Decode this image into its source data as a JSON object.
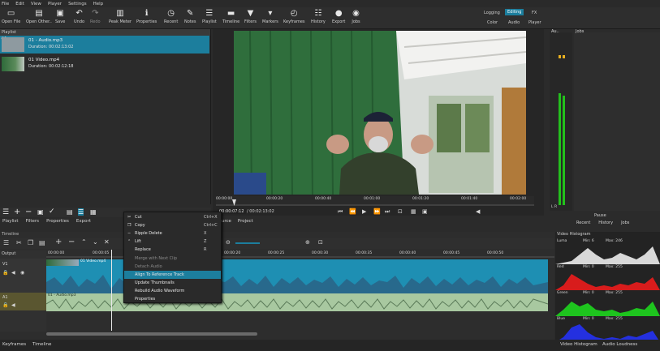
{
  "menu": [
    "File",
    "Edit",
    "View",
    "Player",
    "Settings",
    "Help"
  ],
  "toolbar": [
    {
      "label": "Open File",
      "icon": "folder-icon"
    },
    {
      "label": "Open Other..",
      "icon": "open-other-icon"
    },
    {
      "label": "Save",
      "icon": "save-icon"
    },
    {
      "label": "Undo",
      "icon": "undo-icon"
    },
    {
      "label": "Redo",
      "icon": "redo-icon"
    },
    {
      "label": "Peak Meter",
      "icon": "peak-meter-icon"
    },
    {
      "label": "Properties",
      "icon": "properties-icon"
    },
    {
      "label": "Recent",
      "icon": "recent-icon"
    },
    {
      "label": "Notes",
      "icon": "notes-icon"
    },
    {
      "label": "Playlist",
      "icon": "playlist-icon"
    },
    {
      "label": "Timeline",
      "icon": "timeline-icon"
    },
    {
      "label": "Filters",
      "icon": "filters-icon"
    },
    {
      "label": "Markers",
      "icon": "markers-icon"
    },
    {
      "label": "Keyframes",
      "icon": "keyframes-icon"
    },
    {
      "label": "History",
      "icon": "history-icon"
    },
    {
      "label": "Export",
      "icon": "export-icon"
    },
    {
      "label": "Jobs",
      "icon": "jobs-icon"
    }
  ],
  "layouts": {
    "logging": "Logging",
    "editing": "Editing",
    "fx": "FX",
    "color": "Color",
    "audio": "Audio",
    "player": "Player"
  },
  "playlist": {
    "title": "Playlist",
    "items": [
      {
        "index": "#1",
        "title": "01 - Audio.mp3",
        "duration": "Duration: 00:02:13:02"
      },
      {
        "index": "",
        "title": "01 Video.mp4",
        "duration": "Duration: 00:02:12:18"
      }
    ],
    "tabs": [
      "Playlist",
      "Filters",
      "Properties",
      "Export"
    ]
  },
  "viewer": {
    "ruler": [
      "00:00:00",
      "00:00:20",
      "00:00:40",
      "00:01:00",
      "00:01:20",
      "00:01:40",
      "00:02:00"
    ],
    "timecode": "00:00:07:12",
    "duration": "/ 00:02:13:02",
    "tabs": [
      "Source",
      "Project"
    ]
  },
  "right": {
    "audio_label": "Au..",
    "jobs_label": "Jobs",
    "meter_scale": [
      "0",
      "-5",
      "-10",
      "-15",
      "-20",
      "-25",
      "-30",
      "-35",
      "-40",
      "-50"
    ],
    "meter_lr": "L  R",
    "pause_label": "Pause",
    "tabs": [
      "Recent",
      "History",
      "Jobs"
    ]
  },
  "timeline": {
    "title": "Timeline",
    "output_label": "Output",
    "v1": "V1",
    "a1": "A1",
    "ruler": [
      "00:00:00",
      "00:00:05",
      "00:00:10",
      "00:00:15",
      "00:00:20",
      "00:00:25",
      "00:00:30",
      "00:00:35",
      "00:00:40",
      "00:00:45",
      "00:00:50"
    ],
    "video_clip_label": "01 Video.mp4",
    "audio_clip_label": "01 - Audio.mp3"
  },
  "context_menu": [
    {
      "label": "Cut",
      "shortcut": "Ctrl+X",
      "disabled": false
    },
    {
      "label": "Copy",
      "shortcut": "Ctrl+C",
      "disabled": false
    },
    {
      "label": "Ripple Delete",
      "shortcut": "X",
      "disabled": false
    },
    {
      "label": "Lift",
      "shortcut": "Z",
      "disabled": false
    },
    {
      "label": "Replace",
      "shortcut": "R",
      "disabled": false
    },
    {
      "label": "Merge with Next Clip",
      "shortcut": "",
      "disabled": true
    },
    {
      "label": "Detach Audio",
      "shortcut": "",
      "disabled": true
    },
    {
      "label": "Align To Reference Track",
      "shortcut": "",
      "disabled": false,
      "highlighted": true
    },
    {
      "label": "Update Thumbnails",
      "shortcut": "",
      "disabled": false
    },
    {
      "label": "Rebuild Audio Waveform",
      "shortcut": "",
      "disabled": false
    },
    {
      "label": "Properties",
      "shortcut": "",
      "disabled": false
    }
  ],
  "histogram": {
    "title": "Video Histogram",
    "channels": [
      {
        "name": "Luma",
        "min": "Min: 6",
        "max": "Max: 246",
        "color": "#d8d8d8"
      },
      {
        "name": "Red",
        "min": "Min: 0",
        "max": "Max: 255",
        "color": "#d81c1c"
      },
      {
        "name": "Green",
        "min": "Min: 0",
        "max": "Max: 255",
        "color": "#1ec41e"
      },
      {
        "name": "Blue",
        "min": "Min: 0",
        "max": "Max: 255",
        "color": "#2430e0"
      }
    ]
  },
  "bottom_tabs": {
    "left": [
      "Keyframes",
      "Timeline"
    ],
    "right": [
      "Video Histogram",
      "Audio Loudness"
    ]
  },
  "colors": {
    "accent": "#1c7e9d",
    "clip": "#1e90b4",
    "audio_clip": "#a8c8a0",
    "meter_green": "#23c01c"
  }
}
